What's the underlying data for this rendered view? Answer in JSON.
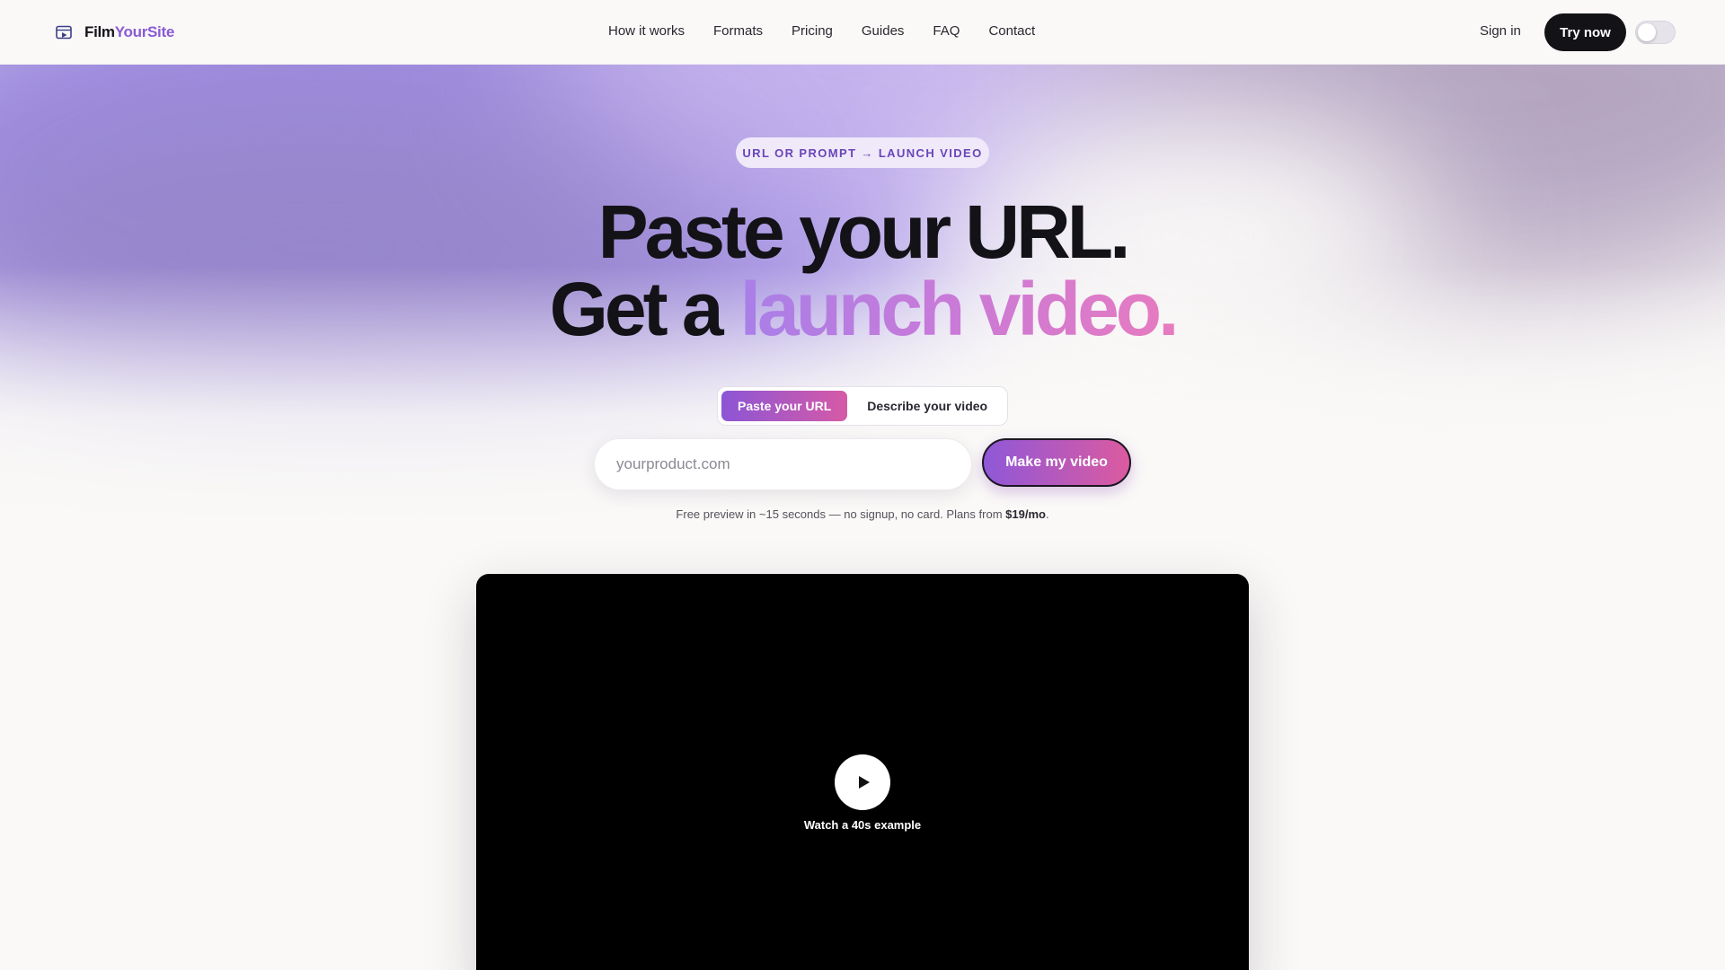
{
  "brand": {
    "name_a": "Film",
    "name_b": "YourSite"
  },
  "nav": {
    "links": [
      "How it works",
      "Formats",
      "Pricing",
      "Guides",
      "FAQ",
      "Contact"
    ],
    "sign_in": "Sign in",
    "try_now": "Try now"
  },
  "hero": {
    "pill": "URL OR PROMPT → LAUNCH VIDEO",
    "headline_line1": "Paste your URL.",
    "headline_line2_a": "Get a",
    "headline_line2_b": "launch video."
  },
  "mode_tabs": {
    "active": "Paste your URL",
    "other": "Describe your video"
  },
  "form": {
    "placeholder": "yourproduct.com",
    "value": "",
    "submit": "Make my video"
  },
  "note": {
    "text": "Free preview in ~15 seconds — no signup, no card. Plans from ",
    "price": "$19/mo",
    "end": "."
  },
  "video": {
    "caption": "Watch a 40s example"
  },
  "icons": {
    "logo": "film-window-icon",
    "play": "play-icon"
  },
  "colors": {
    "accent": "#8b5ad6",
    "gradient_start": "#8c56d6",
    "gradient_end": "#d65aa6",
    "dark": "#131217"
  }
}
